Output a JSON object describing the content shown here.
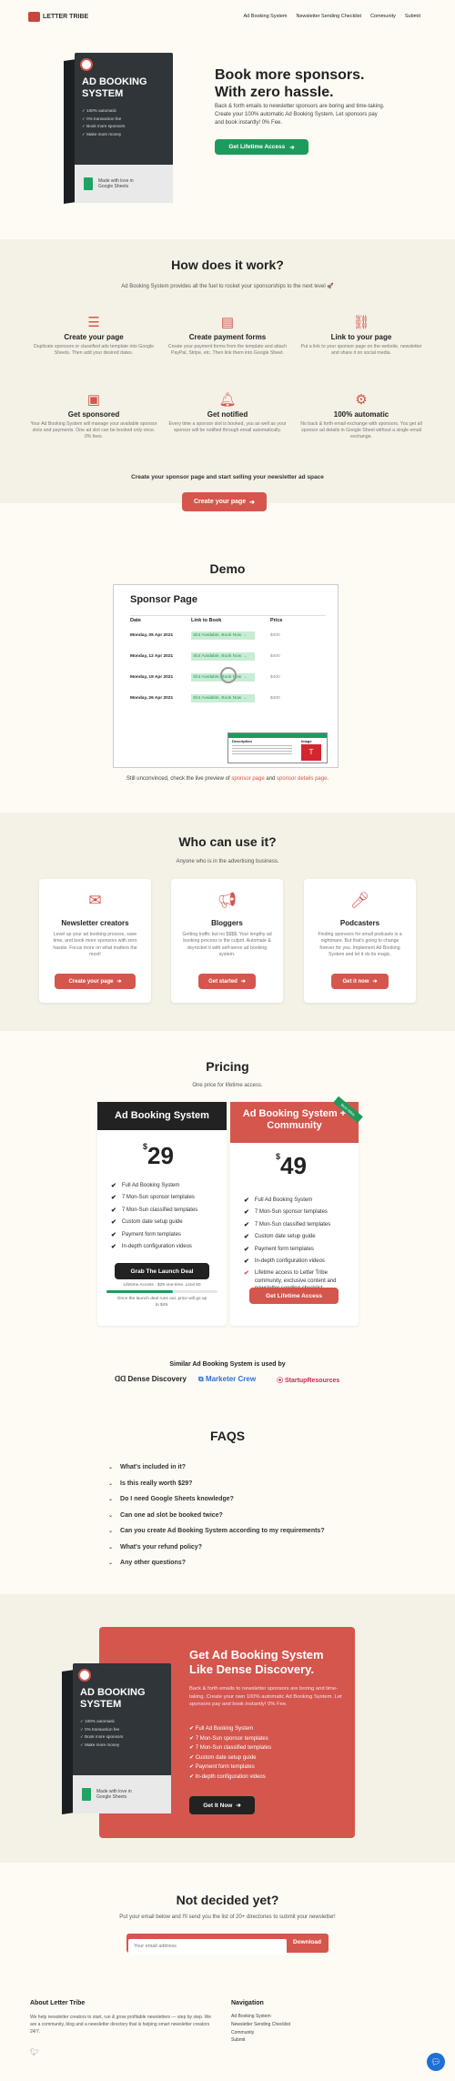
{
  "nav": {
    "brand": "LETTER TRIBE",
    "links": [
      "Ad Booking System",
      "Newsletter Sending Checklist",
      "Community",
      "Submit"
    ]
  },
  "hero": {
    "title1": "Book more sponsors.",
    "title2": "With zero hassle.",
    "desc": "Back & forth emails to newsletter sponsors are boring and time-taking. Create your 100% automatic Ad Booking System. Let sponsors pay and book instantly! 0% Fee.",
    "cta": "Get Lifetime Access"
  },
  "product_box": {
    "title": "AD BOOKING SYSTEM",
    "bullets": [
      "100% automatic",
      "0% transaction fee",
      "Book more sponsors",
      "Make more money"
    ],
    "badge": "Made with love in Google Sheets"
  },
  "how": {
    "title": "How does it work?",
    "subtitle": "Ad Booking System provides all the fuel to rocket your sponsorships to the next level 🚀",
    "features": [
      {
        "icon": "list-icon",
        "title": "Create your page",
        "desc": "Duplicate sponsors or classified ads template into Google Sheets. Then add your desired dates."
      },
      {
        "icon": "form-icon",
        "title": "Create payment forms",
        "desc": "Create your payment forms from the template and attach PayPal, Stripe, etc. Then link them into Google Sheet."
      },
      {
        "icon": "link-icon",
        "title": "Link to your page",
        "desc": "Put a link to your sponsor page on the website, newsletter and share it on social media."
      },
      {
        "icon": "money-icon",
        "title": "Get sponsored",
        "desc": "Your Ad Booking System will manage your available sponsor slots and payments. One ad slot can be booked only once. 0% fees."
      },
      {
        "icon": "bell-icon",
        "title": "Get notified",
        "desc": "Every time a sponsor slot is booked, you as well as your sponsor will be notified through email automatically."
      },
      {
        "icon": "gear-icon",
        "title": "100% automatic",
        "desc": "No back & forth email exchange with sponsors. You get all sponsor ad details in Google Sheet without a single email exchange."
      }
    ],
    "cta_text": "Create your sponsor page and start selling your newsletter ad space",
    "cta": "Create your page"
  },
  "demo": {
    "title": "Demo",
    "page_title": "Sponsor Page",
    "cols": [
      "Date",
      "Link to Book",
      "Price"
    ],
    "rows": [
      {
        "date": "Monday, 05 Apr 2021",
        "link": "Slot Available, Book Now →",
        "price": "$400"
      },
      {
        "date": "Monday, 12 Apr 2021",
        "link": "Slot Available, Book Now →",
        "price": "$400"
      },
      {
        "date": "Monday, 19 Apr 2021",
        "link": "Slot Available, Book Now →",
        "price": "$400"
      },
      {
        "date": "Monday, 26 Apr 2021",
        "link": "Slot Available, Book Now →",
        "price": "$400"
      }
    ],
    "panel_cols": [
      "Description",
      "Image"
    ],
    "note_prefix": "Still unconvinced, check the live preview of",
    "link1": "sponsor page",
    "and": "and",
    "link2": "sponsor details page",
    "period": "."
  },
  "who": {
    "title": "Who can use it?",
    "subtitle": "Anyone who is in the advertising business.",
    "cards": [
      {
        "icon": "newsletter-icon",
        "title": "Newsletter creators",
        "desc": "Level up your ad booking process, save time, and book more sponsors with zero hassle. Focus more on what matters the most!",
        "cta": "Create your page"
      },
      {
        "icon": "megaphone-icon",
        "title": "Bloggers",
        "desc": "Getting traffic but no $$$$. Your lengthy ad booking process is the culprit. Automate & skyrocket it with self-serve ad booking system.",
        "cta": "Get started"
      },
      {
        "icon": "microphone-icon",
        "title": "Podcasters",
        "desc": "Finding sponsors for small podcasts is a nightmare. But that's going to change forever for you. Implement Ad Booking System and let it do its magic.",
        "cta": "Get it now"
      }
    ]
  },
  "pricing": {
    "title": "Pricing",
    "subtitle": "One price for lifetime access.",
    "plan1": {
      "name": "Ad Booking System",
      "currency": "$",
      "price": "29",
      "features": [
        "Full Ad Booking System",
        "7 Mon-Sun sponsor templates",
        "7 Mon-Sun classified templates",
        "Custom date setup guide",
        "Payment form templates",
        "In-depth configuration videos"
      ],
      "cta": "Grab The Launch Deal",
      "progress_label": "Lifetime Access - $29 one-time. Limit 50",
      "progress": 0.6,
      "note": "Once the launch deal runs out, price will go up to $49."
    },
    "plan2": {
      "name": "Ad Booking System + Community",
      "ribbon": "Best Value",
      "currency": "$",
      "price": "49",
      "features": [
        "Full Ad Booking System",
        "7 Mon-Sun sponsor templates",
        "7 Mon-Sun classified templates",
        "Custom date setup guide",
        "Payment form templates",
        "In-depth configuration videos",
        "Lifetime access to Letter Tribe community, exclusive content and newsletter sending checklist."
      ],
      "cta": "Get Lifetime Access"
    }
  },
  "used_by": {
    "title": "Similar Ad Booking System is used by",
    "logos": [
      "Dense Discovery",
      "Marketer Crew",
      "StartupResources"
    ]
  },
  "faqs": {
    "title": "FAQS",
    "items": [
      "What's included in it?",
      "Is this really worth $29?",
      "Do I need Google Sheets knowledge?",
      "Can one ad slot be booked twice?",
      "Can you create Ad Booking System according to my requirements?",
      "What's your refund policy?",
      "Any other questions?"
    ]
  },
  "promo": {
    "title": "Get Ad Booking System Like Dense Discovery.",
    "desc": "Back & forth emails to newsletter sponsors are boring and time-taking. Create your own 100% automatic Ad Booking System. Let sponsors pay and book instantly! 0% Fee.",
    "features": [
      "Full Ad Booking System",
      "7 Mon-Sun sponsor templates",
      "7 Mon-Sun classified templates",
      "Custom date setup guide",
      "Payment form templates",
      "In-depth configuration videos"
    ],
    "cta": "Get It Now"
  },
  "newsletter": {
    "title": "Not decided yet?",
    "desc": "Put your email below and I'll send you the list of 20+ directories to submit your newsletter!",
    "placeholder": "Your email address",
    "cta": "Download"
  },
  "footer": {
    "about_title": "About Letter Tribe",
    "about_desc": "We help newsletter creators to start, run & grow profitable newsletters — step by step. We are a community, blog and a newsletter directory that is helping smart newsletter creators 24/7.",
    "nav_title": "Navigation",
    "nav_links": [
      "Ad Booking System",
      "Newsletter Sending Checklist",
      "Community",
      "Submit"
    ]
  },
  "colors": {
    "accent": "#d4564d",
    "bg": "#fdfbf4",
    "dark": "#2c2c2c"
  }
}
